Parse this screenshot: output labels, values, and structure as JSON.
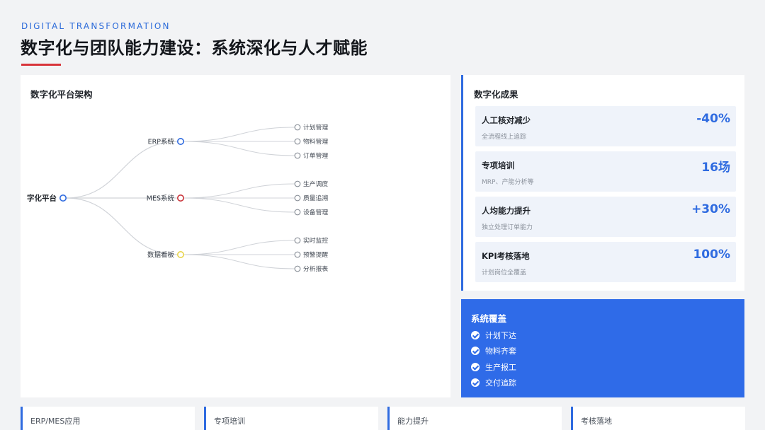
{
  "header": {
    "eyebrow": "DIGITAL TRANSFORMATION",
    "title": "数字化与团队能力建设：系统深化与人才赋能"
  },
  "platform": {
    "heading": "数字化平台架构",
    "root": "字化平台",
    "branches": [
      {
        "label": "ERP系统",
        "color": "#2f6be0",
        "children": [
          "计划管理",
          "物料管理",
          "订单管理"
        ]
      },
      {
        "label": "MES系统",
        "color": "#c9343a",
        "children": [
          "生产调度",
          "质量追溯",
          "设备管理"
        ]
      },
      {
        "label": "数据看板",
        "color": "#e8d44a",
        "children": [
          "实时监控",
          "预警提醒",
          "分析报表"
        ]
      }
    ]
  },
  "results": {
    "heading": "数字化成果",
    "metrics": [
      {
        "title": "人工核对减少",
        "sub": "全流程线上追踪",
        "value": "-40%"
      },
      {
        "title": "专项培训",
        "sub": "MRP、产能分析等",
        "value": "16场"
      },
      {
        "title": "人均能力提升",
        "sub": "独立处理订单能力",
        "value": "+30%"
      },
      {
        "title": "KPI考核落地",
        "sub": "计划岗位全覆盖",
        "value": "100%"
      }
    ]
  },
  "coverage": {
    "heading": "系统覆盖",
    "items": [
      "计划下达",
      "物料齐套",
      "生产报工",
      "交付追踪"
    ]
  },
  "bottom_cards": [
    "ERP/MES应用",
    "专项培训",
    "能力提升",
    "考核落地"
  ],
  "colors": {
    "accent_blue": "#2f6be0",
    "accent_red": "#d8343a",
    "coverage_bg": "#2f6be8"
  }
}
